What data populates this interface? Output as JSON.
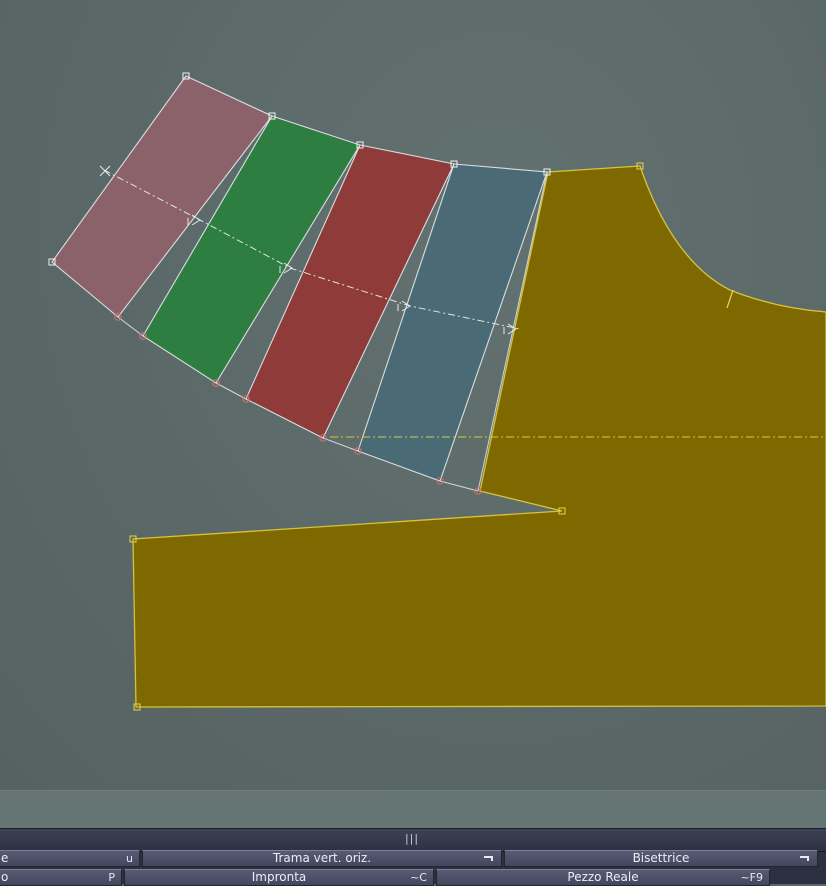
{
  "canvas": {
    "background": "#5a6766",
    "pieces": [
      {
        "name": "pink-panel",
        "fill": "#8c626a"
      },
      {
        "name": "green-panel",
        "fill": "#2e7e41"
      },
      {
        "name": "red-panel",
        "fill": "#8e3b3a"
      },
      {
        "name": "blue-panel",
        "fill": "#4a6a76"
      },
      {
        "name": "yellow-bodice",
        "fill": "#7e6800"
      }
    ]
  },
  "toolbar": {
    "row1": [
      {
        "label": "e",
        "key": "u"
      },
      {
        "label": "Trama vert. oriz.",
        "flag": true
      },
      {
        "label": "Bisettrice",
        "flag": true
      }
    ],
    "row2": [
      {
        "label": "o",
        "key": "P"
      },
      {
        "label": "Impronta",
        "key": "~C"
      },
      {
        "label": "Pezzo Reale",
        "key": "~F9"
      }
    ]
  }
}
